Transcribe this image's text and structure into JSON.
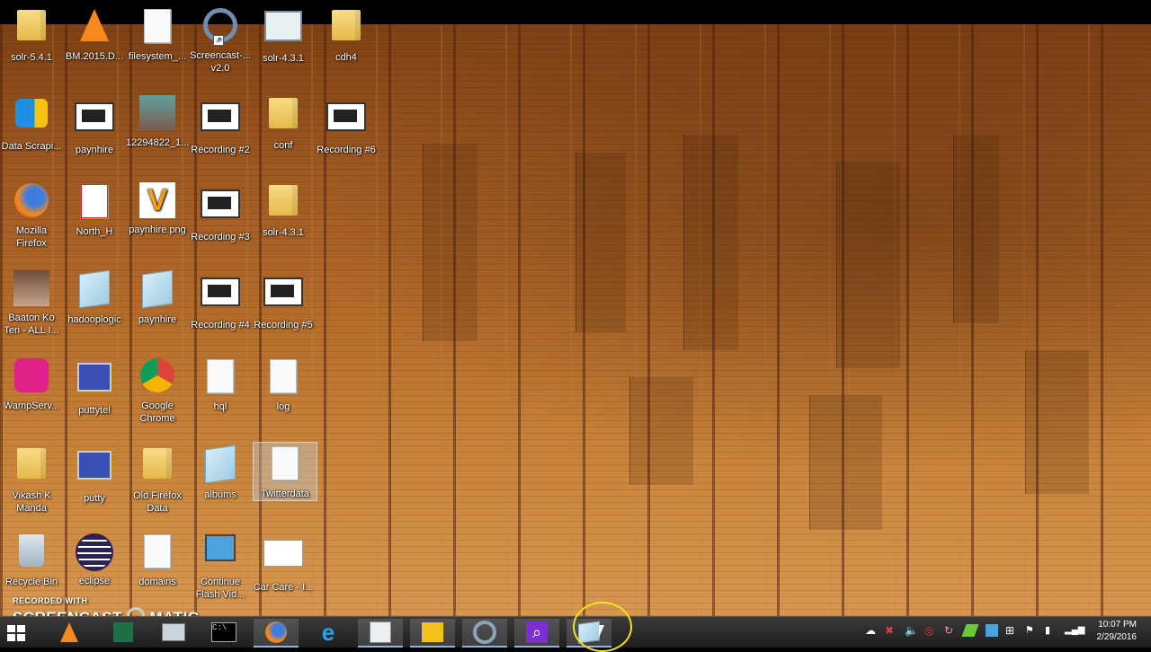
{
  "desktop_icons": [
    {
      "label": "solr-5.4.1",
      "icon": "folder-icon"
    },
    {
      "label": "BM.2015.D...",
      "icon": "vlc-icon"
    },
    {
      "label": "filesystem_...",
      "icon": "document-icon"
    },
    {
      "label": "Screencast-... v2.0",
      "icon": "screencast-icon"
    },
    {
      "label": "solr-4.3.1",
      "icon": "window-icon"
    },
    {
      "label": "cdh4",
      "icon": "folder-icon"
    },
    {
      "label": "Data Scrapi...",
      "icon": "data-scraping-icon"
    },
    {
      "label": "paynhire",
      "icon": "video-icon"
    },
    {
      "label": "12294822_1...",
      "icon": "photo-icon"
    },
    {
      "label": "Recording #2",
      "icon": "video-icon"
    },
    {
      "label": "conf",
      "icon": "folder-icon"
    },
    {
      "label": "Recording #6",
      "icon": "video-icon"
    },
    {
      "label": "Mozilla Firefox",
      "icon": "firefox-icon"
    },
    {
      "label": "North_H",
      "icon": "pdf-icon"
    },
    {
      "label": "paynhire.png",
      "icon": "image-icon"
    },
    {
      "label": "Recording #3",
      "icon": "video-icon"
    },
    {
      "label": "solr-4.3.1",
      "icon": "folder-icon"
    },
    {
      "label": "Baaton Ko Teri - ALL I...",
      "icon": "video-icon"
    },
    {
      "label": "hadooplogic",
      "icon": "notepad-icon"
    },
    {
      "label": "paynhire",
      "icon": "notepad-icon"
    },
    {
      "label": "Recording #4",
      "icon": "video-icon"
    },
    {
      "label": "Recording #5",
      "icon": "video-icon"
    },
    {
      "label": "WampServ...",
      "icon": "wampserver-icon"
    },
    {
      "label": "puttytel",
      "icon": "putty-icon"
    },
    {
      "label": "Google Chrome",
      "icon": "chrome-icon"
    },
    {
      "label": "hql",
      "icon": "document-icon"
    },
    {
      "label": "log",
      "icon": "document-icon"
    },
    {
      "label": "Vikash K Manda",
      "icon": "user-folder-icon"
    },
    {
      "label": "putty",
      "icon": "putty-icon"
    },
    {
      "label": "Old Firefox Data",
      "icon": "folder-icon"
    },
    {
      "label": "albums",
      "icon": "notepad-icon"
    },
    {
      "label": "Twitterdata",
      "icon": "document-icon"
    },
    {
      "label": "Recycle Bin",
      "icon": "recycle-bin-icon"
    },
    {
      "label": "eclipse",
      "icon": "eclipse-icon"
    },
    {
      "label": "domains",
      "icon": "document-icon"
    },
    {
      "label": "Continue Flash Vid...",
      "icon": "network-icon"
    },
    {
      "label": "Car Care - I...",
      "icon": "webpage-icon"
    }
  ],
  "watermark": {
    "line1": "RECORDED WITH",
    "line2": "SCREENCAST",
    "line3": "MATIC"
  },
  "taskbar": {
    "apps": [
      "start-icon",
      "vlc-icon",
      "excel-icon",
      "printer-icon",
      "command-prompt-icon",
      "firefox-icon",
      "internet-explorer-icon",
      "task-manager-icon",
      "file-manager-icon",
      "screencast-icon",
      "search-app-icon",
      "notepad-icon"
    ],
    "clock_time": "10:07 PM",
    "clock_date": "2/29/2016"
  }
}
